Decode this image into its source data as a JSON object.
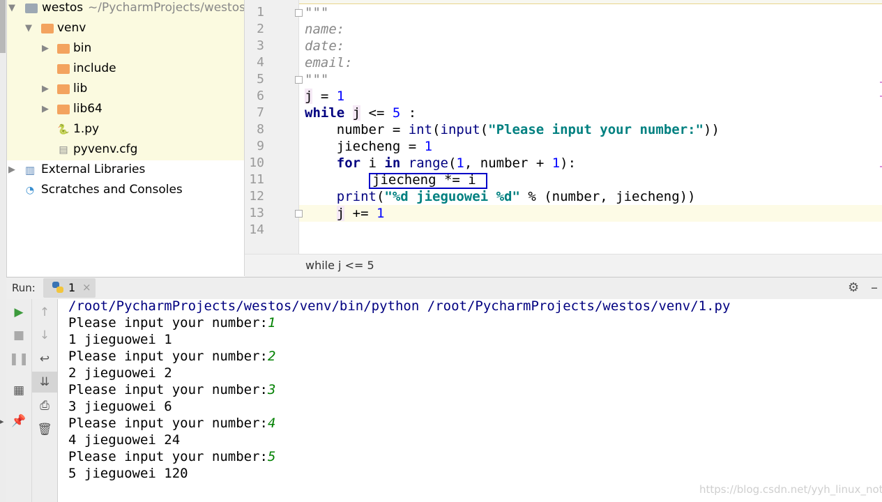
{
  "project_tree": {
    "root": {
      "name": "westos",
      "path": "~/PycharmProjects/westos"
    },
    "items": [
      {
        "label": "venv"
      },
      {
        "label": "bin"
      },
      {
        "label": "include"
      },
      {
        "label": "lib"
      },
      {
        "label": "lib64"
      },
      {
        "label": "1.py"
      },
      {
        "label": "pyvenv.cfg"
      },
      {
        "label": "External Libraries"
      },
      {
        "label": "Scratches and Consoles"
      }
    ]
  },
  "editor": {
    "line_numbers": [
      "1",
      "2",
      "3",
      "4",
      "5",
      "6",
      "7",
      "8",
      "9",
      "10",
      "11",
      "12",
      "13",
      "14"
    ],
    "lines": {
      "l1": "\"\"\"",
      "l2": "name:",
      "l3": "date:",
      "l4": "email:",
      "l5": "\"\"\"",
      "l6_j": "j",
      "l6_op": " = ",
      "l6_n": "1",
      "l7_kw": "while",
      "l7_j": "j",
      "l7_op": " <= ",
      "l7_n": "5",
      "l7_end": " :",
      "l8_a": "    number = ",
      "l8_int": "int",
      "l8_p1": "(",
      "l8_input": "input",
      "l8_p2": "(",
      "l8_str": "\"Please input your number:\"",
      "l8_p3": "))",
      "l9_a": "    jiecheng = ",
      "l9_n": "1",
      "l10_ind": "    ",
      "l10_for": "for",
      "l10_i": " i ",
      "l10_in": "in",
      "l10_sp": " ",
      "l10_range": "range",
      "l10_p": "(",
      "l10_n1": "1",
      "l10_mid": ", number + ",
      "l10_n2": "1",
      "l10_end": "):",
      "l11": "jiecheng *= i",
      "l12_ind": "    ",
      "l12_print": "print",
      "l12_p": "(",
      "l12_str": "\"%d jieguowei %d\"",
      "l12_rest": " % (number, jiecheng))",
      "l13_ind": "    ",
      "l13_j": "j",
      "l13_op": " += ",
      "l13_n": "1"
    },
    "breadcrumb": "while j <= 5"
  },
  "run_panel": {
    "label": "Run:",
    "tab_name": "1",
    "close_glyph": "×",
    "console": {
      "command": "/root/PycharmProjects/westos/venv/bin/python /root/PycharmProjects/westos/venv/1.py",
      "prompt": "Please input your number:",
      "inputs": [
        "1",
        "2",
        "3",
        "4",
        "5"
      ],
      "outputs": [
        "1 jieguowei 1",
        "2 jieguowei 2",
        "3 jieguowei 6",
        "4 jieguowei 24",
        "5 jieguowei 120"
      ]
    }
  },
  "watermark": "https://blog.csdn.net/yyh_linux_note",
  "colors": {
    "keyword": "#000080",
    "number": "#0000ff",
    "string": "#008080",
    "user_input": "#008000",
    "highlight_box": "#0000c8",
    "folder": "#f3a35f"
  }
}
